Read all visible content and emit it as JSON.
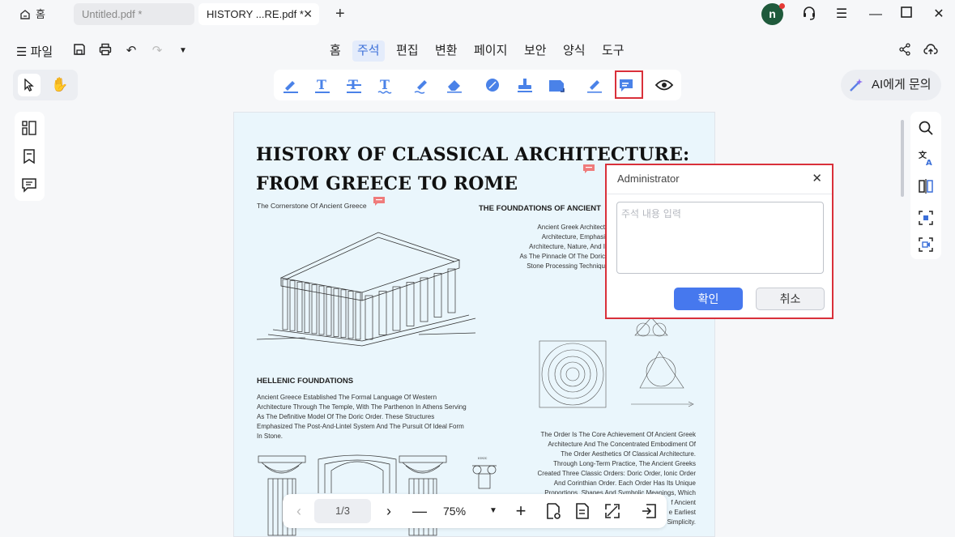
{
  "tabs": {
    "home_label": "홈",
    "items": [
      {
        "label": "Untitled.pdf *"
      },
      {
        "label": "HISTORY ...RE.pdf *"
      }
    ]
  },
  "user": {
    "initial": "n"
  },
  "menu": {
    "file_label": "파일",
    "tabs": [
      "홈",
      "주석",
      "편집",
      "변환",
      "페이지",
      "보안",
      "양식",
      "도구"
    ],
    "active_tab": "주석"
  },
  "toolbar": {
    "ai_label": "AI에게 문의"
  },
  "document": {
    "title_line1": "HISTORY OF CLASSICAL  ARCHITECTURE:",
    "title_line2": "FROM GREECE TO ROME",
    "subtitle": "The Cornerstone Of Ancient Greece",
    "foundations_head": "THE FOUNDATIONS OF ANCIENT",
    "foundations_lines": [
      "Ancient Greek Architect",
      "Architecture, Emphasi",
      "Architecture, Nature, And I",
      "As The Pinnacle Of The Doric",
      "Stone Processing Techniqu"
    ],
    "hellenic_head": "HELLENIC FOUNDATIONS",
    "hellenic_lines": [
      "Ancient Greece Established The Formal Language Of Western",
      "Architecture Through The Temple, With The Parthenon In Athens Serving",
      "As The Definitive Model Of The Doric Order. These Structures",
      "Emphasized The Post-And-Lintel System And The Pursuit Of Ideal Form",
      "In Stone."
    ],
    "order_lines": [
      "The Order Is The Core Achievement Of Ancient Greek",
      "Architecture And The Concentrated Embodiment Of",
      "The Order Aesthetics Of Classical Architecture.",
      "Through Long-Term Practice, The Ancient Greeks",
      "Created Three Classic Orders: Doric Order, Ionic Order",
      "And Corinthian Order. Each Order Has Its Unique",
      "Proportions, Shapes And Symbolic Meanings, Which",
      "f Ancient",
      "e Earliest",
      "Simplicity."
    ],
    "ionic_label": "IONIC"
  },
  "comment_popup": {
    "author": "Administrator",
    "placeholder": "주석 내용 입력",
    "confirm_label": "확인",
    "cancel_label": "취소"
  },
  "navigation": {
    "page_indicator": "1/3",
    "zoom": "75%"
  },
  "colors": {
    "accent": "#4678ee",
    "highlight_border": "#d9303a",
    "page_bg": "#eaf6fc",
    "avatar_bg": "#1f5a3c"
  }
}
